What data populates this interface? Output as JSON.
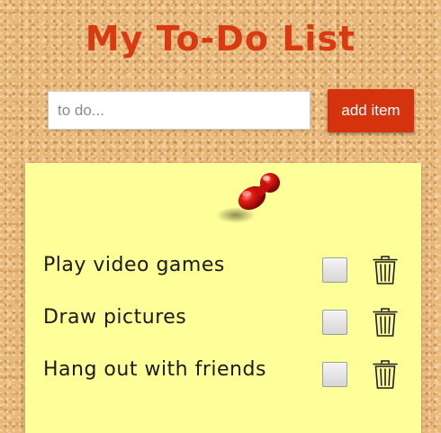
{
  "header": {
    "title": "My To-Do List"
  },
  "form": {
    "input_value": "",
    "input_placeholder": "to do...",
    "add_label": "add item"
  },
  "list": {
    "items": [
      {
        "label": "Play video games",
        "checked": false
      },
      {
        "label": "Draw pictures",
        "checked": false
      },
      {
        "label": "Hang out with friends",
        "checked": false
      }
    ]
  },
  "icons": {
    "pin": "push-pin-icon",
    "delete": "trash-icon"
  },
  "colors": {
    "title": "#d93a12",
    "button": "#d4330d",
    "note": "#ffff99",
    "pin": "#d01414"
  }
}
